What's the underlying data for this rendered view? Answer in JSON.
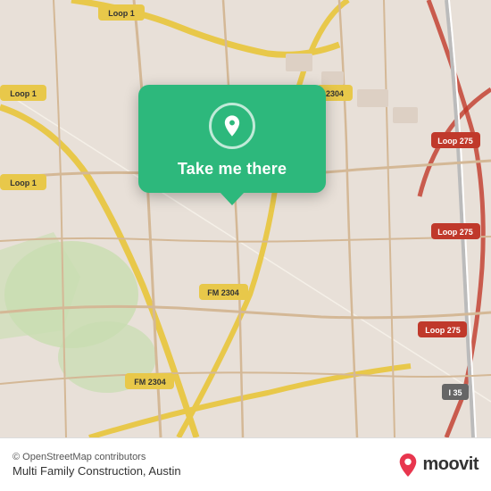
{
  "map": {
    "background_color": "#e8e0d8",
    "center_lat": 30.22,
    "center_lng": -97.78
  },
  "popup": {
    "button_label": "Take me there",
    "pin_icon": "location-pin-icon",
    "background_color": "#2db87c"
  },
  "bottom_bar": {
    "copyright": "© OpenStreetMap contributors",
    "location_name": "Multi Family Construction, Austin",
    "logo_text": "moovit"
  }
}
